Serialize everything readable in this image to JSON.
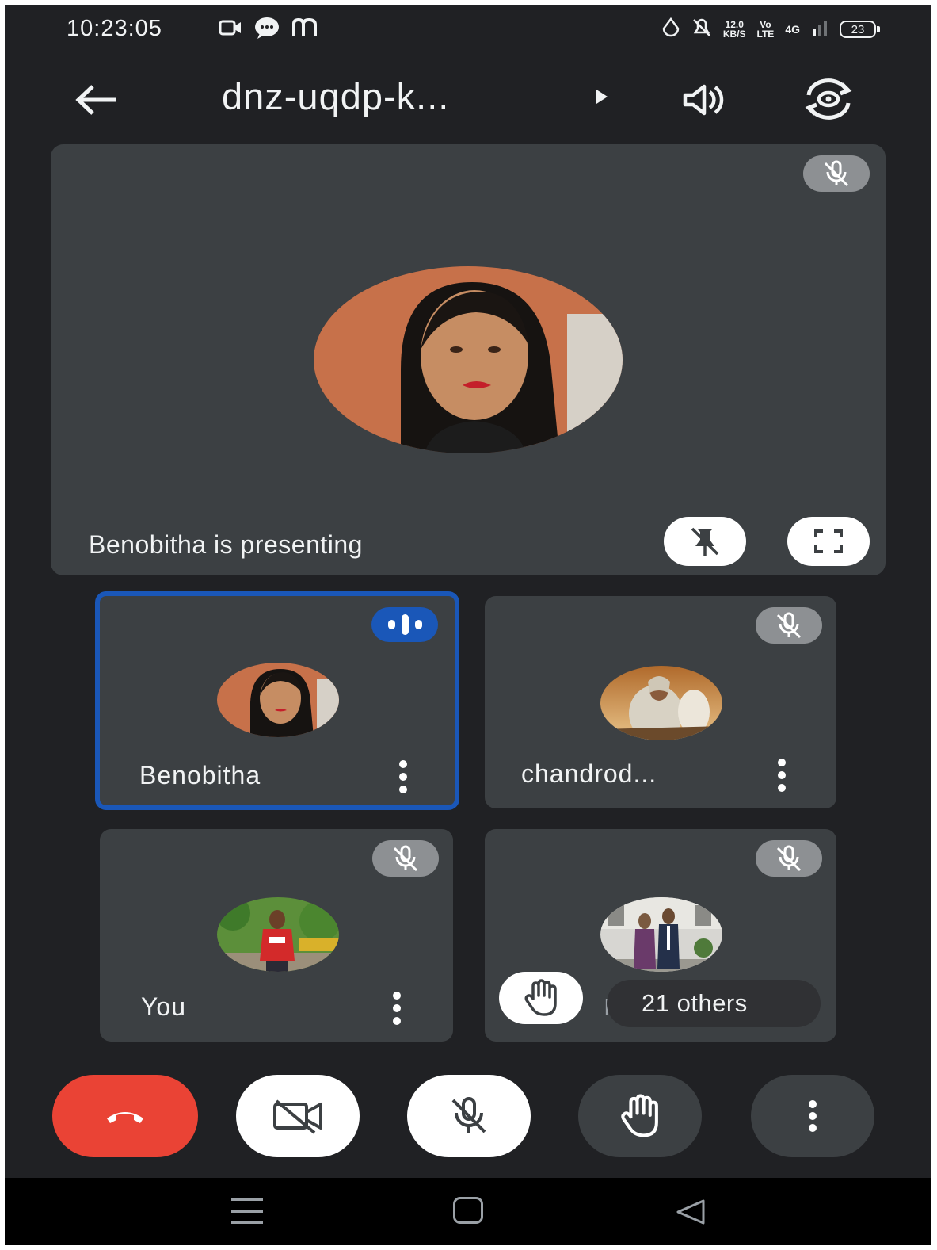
{
  "status_bar": {
    "time": "10:23:05",
    "network_speed_value": "12.0",
    "network_speed_unit": "KB/S",
    "volte_top": "Vo",
    "volte_bottom": "LTE",
    "network_type": "4G",
    "battery": "23",
    "left_app_icons": [
      "video-camera-icon",
      "chat-bubble-icon",
      "m-app-icon"
    ],
    "right_icons": [
      "drop-icon",
      "bell-muted-icon",
      "signal-icon",
      "battery-icon"
    ]
  },
  "header": {
    "meeting_code": "dnz-uqdp-k...",
    "icons": [
      "back-arrow-icon",
      "play-arrow-icon",
      "speaker-icon",
      "switch-camera-icon"
    ]
  },
  "main_tile": {
    "presenting_text": "Benobitha is presenting",
    "icons": [
      "mic-off-icon",
      "unpin-icon",
      "fullscreen-icon"
    ]
  },
  "participants": [
    {
      "name": "Benobitha",
      "state": "speaking"
    },
    {
      "name": "chandrod...",
      "state": "muted"
    },
    {
      "name": "You",
      "state": "muted"
    },
    {
      "name": "Im",
      "state": "muted"
    }
  ],
  "others_count": "21 others",
  "controls": [
    "end-call",
    "camera-off",
    "mic-off",
    "raise-hand",
    "more-options"
  ],
  "colors": {
    "background": "#202124",
    "tile": "#3c4043",
    "active_speaker": "#1a57b8",
    "end_call": "#ea4335",
    "muted_badge": "#8d9093"
  }
}
